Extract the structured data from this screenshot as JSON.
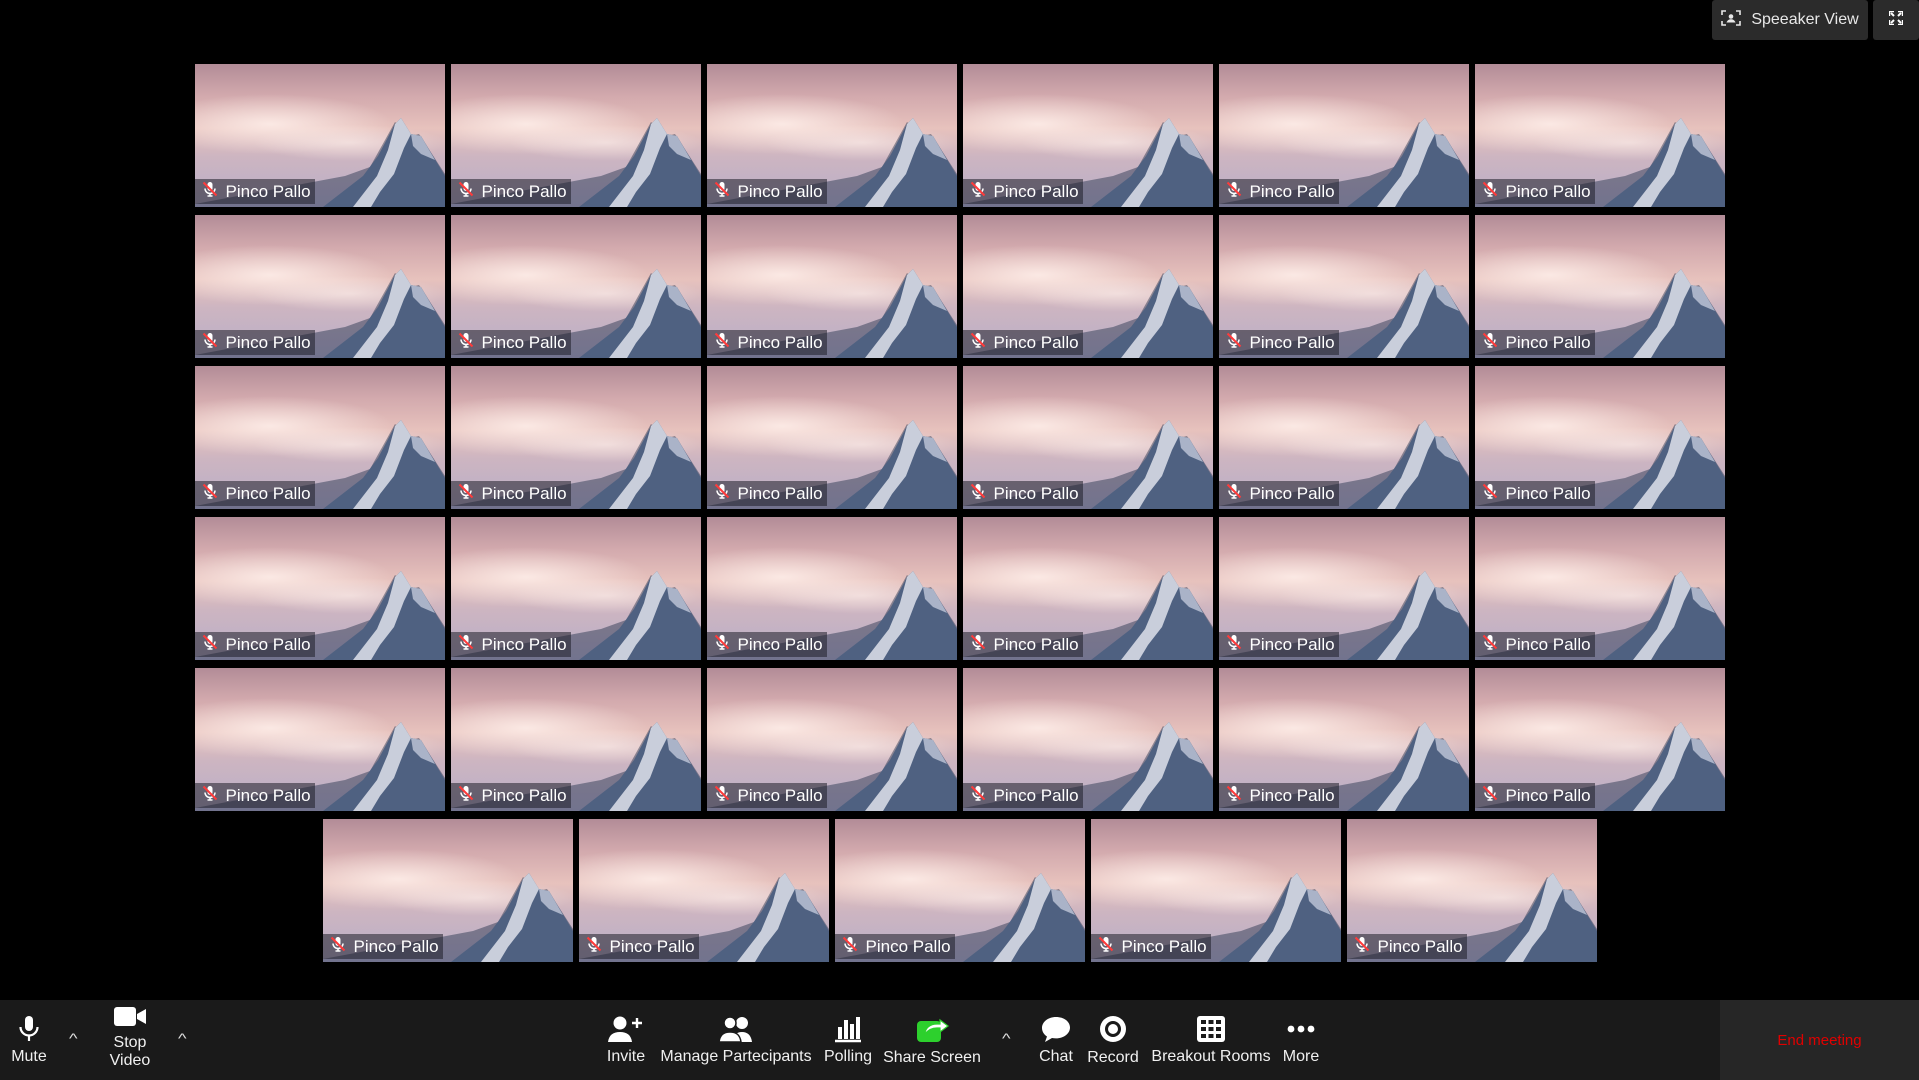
{
  "top_controls": {
    "speaker_view_label": "Speeaker View"
  },
  "participants": [
    "Pinco Pallo",
    "Pinco Pallo",
    "Pinco Pallo",
    "Pinco Pallo",
    "Pinco Pallo",
    "Pinco Pallo",
    "Pinco Pallo",
    "Pinco Pallo",
    "Pinco Pallo",
    "Pinco Pallo",
    "Pinco Pallo",
    "Pinco Pallo",
    "Pinco Pallo",
    "Pinco Pallo",
    "Pinco Pallo",
    "Pinco Pallo",
    "Pinco Pallo",
    "Pinco Pallo",
    "Pinco Pallo",
    "Pinco Pallo",
    "Pinco Pallo",
    "Pinco Pallo",
    "Pinco Pallo",
    "Pinco Pallo",
    "Pinco Pallo",
    "Pinco Pallo",
    "Pinco Pallo",
    "Pinco Pallo",
    "Pinco Pallo",
    "Pinco Pallo",
    "Pinco Pallo",
    "Pinco Pallo",
    "Pinco Pallo",
    "Pinco Pallo",
    "Pinco Pallo"
  ],
  "toolbar": {
    "mute_label": "Mute",
    "stop_video_label_1": "Stop",
    "stop_video_label_2": "Video",
    "invite_label": "Invite",
    "manage_participants_label": "Manage Partecipants",
    "polling_label": "Polling",
    "share_screen_label": "Share Screen",
    "chat_label": "Chat",
    "record_label": "Record",
    "breakout_rooms_label": "Breakout Rooms",
    "more_label": "More",
    "end_meeting_label": "End meeting"
  },
  "colors": {
    "background": "#000000",
    "toolbar": "#1a1a1a",
    "share_screen_accent": "#2dd02d",
    "end_meeting": "#e00000"
  }
}
